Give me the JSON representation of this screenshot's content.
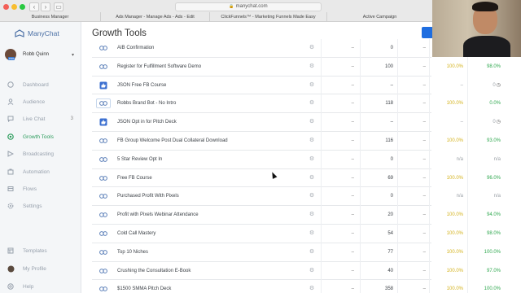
{
  "browser": {
    "url": "manychat.com",
    "tabs": [
      "Business Manager",
      "Ads Manager - Manage Ads - Ads - Edit",
      "ClickFunnels™ - Marketing Funnels Made Easy",
      "Active Campaign"
    ]
  },
  "sidebar": {
    "brand": "ManyChat",
    "user_name": "Robb Quinn",
    "avatar_badge": "PRO",
    "items": [
      {
        "label": "Dashboard",
        "icon": "dashboard-icon"
      },
      {
        "label": "Audience",
        "icon": "audience-icon"
      },
      {
        "label": "Live Chat",
        "icon": "chat-icon",
        "count": "3"
      },
      {
        "label": "Growth Tools",
        "icon": "growth-tools-icon",
        "active": true
      },
      {
        "label": "Broadcasting",
        "icon": "broadcast-icon"
      },
      {
        "label": "Automation",
        "icon": "automation-icon"
      },
      {
        "label": "Flows",
        "icon": "flows-icon"
      },
      {
        "label": "Settings",
        "icon": "settings-icon"
      }
    ],
    "bottom_items": [
      {
        "label": "Templates",
        "icon": "templates-icon"
      },
      {
        "label": "My Profile",
        "icon": "profile-icon"
      },
      {
        "label": "Help",
        "icon": "help-icon"
      }
    ]
  },
  "main": {
    "title": "Growth Tools",
    "rows": [
      {
        "icon": "link",
        "name": "AIB Confirmation",
        "a": "–",
        "b": "0",
        "c": "–",
        "d": "",
        "e": ""
      },
      {
        "icon": "link",
        "name": "Register for Fulfillment Software Demo",
        "a": "–",
        "b": "100",
        "c": "–",
        "d": "100.0%",
        "e": "98.0%"
      },
      {
        "icon": "like",
        "name": "JSON Free FB Course",
        "a": "–",
        "b": "–",
        "c": "–",
        "d": "–",
        "e": "0",
        "clock": true
      },
      {
        "icon": "link",
        "selected": true,
        "name": "Robbs Brand Bot - No Intro",
        "a": "–",
        "b": "118",
        "c": "–",
        "d": "100.0%",
        "e": "0.0%"
      },
      {
        "icon": "like",
        "name": "JSON Opt in for Pitch Deck",
        "a": "–",
        "b": "–",
        "c": "–",
        "d": "–",
        "e": "0",
        "clock": true
      },
      {
        "icon": "link",
        "name": "FB Group Welcome Post Dual Collateral Download",
        "a": "–",
        "b": "116",
        "c": "–",
        "d": "100.0%",
        "e": "93.0%"
      },
      {
        "icon": "link",
        "name": "5 Star Review Opt In",
        "a": "–",
        "b": "0",
        "c": "–",
        "d": "n/a",
        "e": "n/a",
        "na": true
      },
      {
        "icon": "link",
        "name": "Free FB Course",
        "a": "–",
        "b": "69",
        "c": "–",
        "d": "100.0%",
        "e": "96.0%"
      },
      {
        "icon": "link",
        "name": "Purchased Profit With Pixels",
        "a": "–",
        "b": "0",
        "c": "–",
        "d": "n/a",
        "e": "n/a",
        "na": true
      },
      {
        "icon": "link",
        "name": "Profit with Pixels Webinar Attendance",
        "a": "–",
        "b": "20",
        "c": "–",
        "d": "100.0%",
        "e": "94.0%"
      },
      {
        "icon": "link",
        "name": "Cold Call Mastery",
        "a": "–",
        "b": "54",
        "c": "–",
        "d": "100.0%",
        "e": "98.0%"
      },
      {
        "icon": "link",
        "name": "Top 10 Niches",
        "a": "–",
        "b": "77",
        "c": "–",
        "d": "100.0%",
        "e": "100.0%"
      },
      {
        "icon": "link",
        "name": "Crushing the Consultation E-Book",
        "a": "–",
        "b": "40",
        "c": "–",
        "d": "100.0%",
        "e": "97.0%"
      },
      {
        "icon": "link",
        "name": "$1500 SMMA Pitch Deck",
        "a": "–",
        "b": "358",
        "c": "–",
        "d": "100.0%",
        "e": "100.0%"
      }
    ]
  },
  "colors": {
    "accent_green": "#2c9c5c",
    "brand_blue": "#4a6fa5",
    "yellow": "#d4b31e",
    "green": "#2fa84f"
  }
}
